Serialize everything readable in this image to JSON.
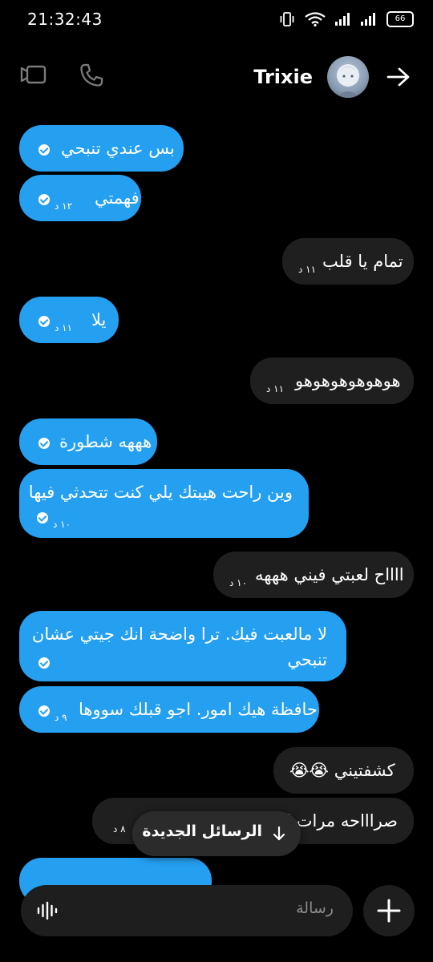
{
  "status_bar": {
    "time": "21:32:43",
    "battery": "66"
  },
  "header": {
    "contact_name": "Trixie",
    "icons": [
      "video-call-icon",
      "phone-icon",
      "avatar",
      "arrow-right-icon"
    ]
  },
  "messages": [
    {
      "direction": "sent",
      "text": "بس عندي تنبحي",
      "time": "",
      "status": "read"
    },
    {
      "direction": "sent",
      "text": "فهمتي",
      "time": "١٢ د",
      "status": "read"
    },
    {
      "direction": "received",
      "text": "تمام يا قلب",
      "time": "١١ د"
    },
    {
      "direction": "sent",
      "text": "يلا",
      "time": "١١ د",
      "status": "read"
    },
    {
      "direction": "received",
      "text": "هوهوهوهوهوهو",
      "time": "١١ د"
    },
    {
      "direction": "sent",
      "text": "هههه شطورة",
      "time": "",
      "status": "read"
    },
    {
      "direction": "sent",
      "text": "وين راحت هيبتك يلي كنت تتحدثي فيها",
      "time": "١٠ د",
      "status": "read"
    },
    {
      "direction": "received",
      "text": "ااااح لعبتي فيني هههه",
      "time": "١٠ د"
    },
    {
      "direction": "sent",
      "lines": [
        "لا مالعبت فيك. ترا واضحة انك جيتي عشان",
        "تنبحي"
      ],
      "time": "",
      "status": "read"
    },
    {
      "direction": "sent",
      "text": "حافظة هيك امور. اجو قبلك سووها",
      "time": "٩ د",
      "status": "read"
    },
    {
      "direction": "received",
      "text": "كشفتيني 😭😭",
      "time": ""
    },
    {
      "direction": "received",
      "text": "صراااحه مرات ا",
      "time": "٨ د"
    }
  ],
  "new_messages_button": {
    "label": "الرسائل الجديدة",
    "icon": "arrow-down-icon"
  },
  "composer": {
    "placeholder": "رسالة",
    "left_icon": "voice-waveform-icon",
    "add_icon": "plus-icon"
  },
  "colors": {
    "sent_bubble": "#259ff0",
    "received_bubble": "#1f1f1f",
    "background": "#000000"
  }
}
